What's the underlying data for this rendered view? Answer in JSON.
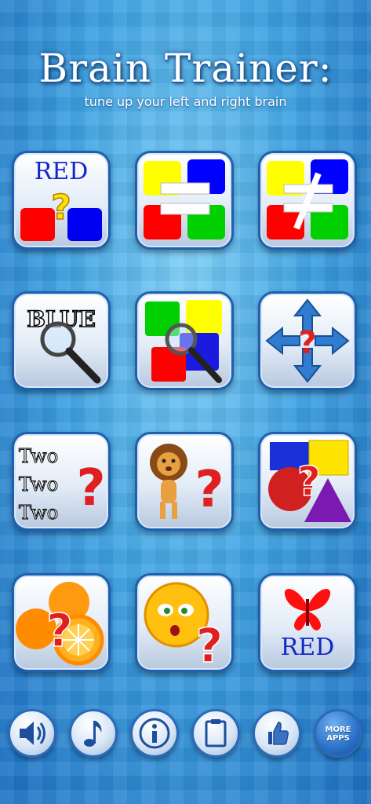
{
  "header": {
    "title": "Brain Trainer:",
    "subtitle": "tune up your left and right brain"
  },
  "tiles": {
    "color_word": {
      "word": "RED"
    },
    "word_search": {
      "word": "BLUE"
    },
    "repeated_words": {
      "words": [
        "Two",
        "Two",
        "Two"
      ]
    },
    "color_word_butterfly": {
      "word": "RED"
    }
  },
  "toolbar": {
    "more_apps": {
      "line1": "MORE",
      "line2": "APPS"
    }
  },
  "icons": {
    "sound": "speaker-icon",
    "music": "music-note-icon",
    "info": "info-icon",
    "clipboard": "clipboard-icon",
    "like": "thumbs-up-icon"
  },
  "colors": {
    "accent_blue": "#1d5fb1",
    "red": "#ff0000",
    "yellow": "#ffff00",
    "green": "#00d000",
    "blue": "#0000ff"
  }
}
